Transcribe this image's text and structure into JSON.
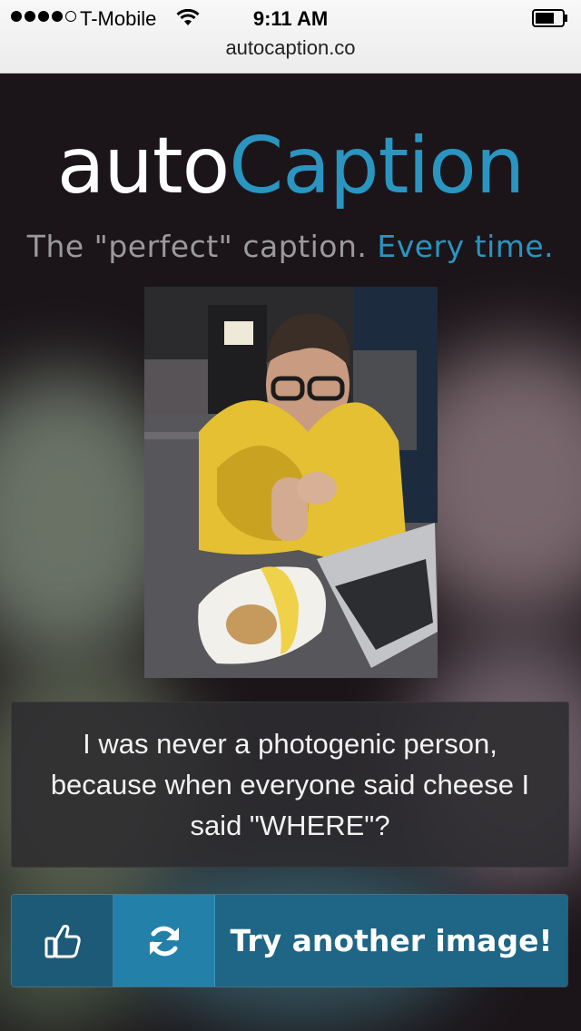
{
  "status_bar": {
    "carrier": "T-Mobile",
    "time": "9:11 AM",
    "signal_bars_filled": 4,
    "signal_bars_total": 5
  },
  "browser": {
    "url": "autocaption.co"
  },
  "logo": {
    "part1": "auto",
    "part2": "Caption"
  },
  "tagline": {
    "part1": "The \"perfect\" caption.",
    "part2": "Every time."
  },
  "photo": {
    "icon": "photo-image"
  },
  "caption": {
    "text": "I was never a photogenic person, because when everyone said cheese I said \"WHERE\"?"
  },
  "actions": {
    "like_icon": "thumbs-up-icon",
    "refresh_icon": "refresh-icon",
    "try_another_label": "Try another image!"
  },
  "colors": {
    "accent": "#2a95c0",
    "button_dark": "#1d5a77",
    "button_active": "#2381a9"
  }
}
